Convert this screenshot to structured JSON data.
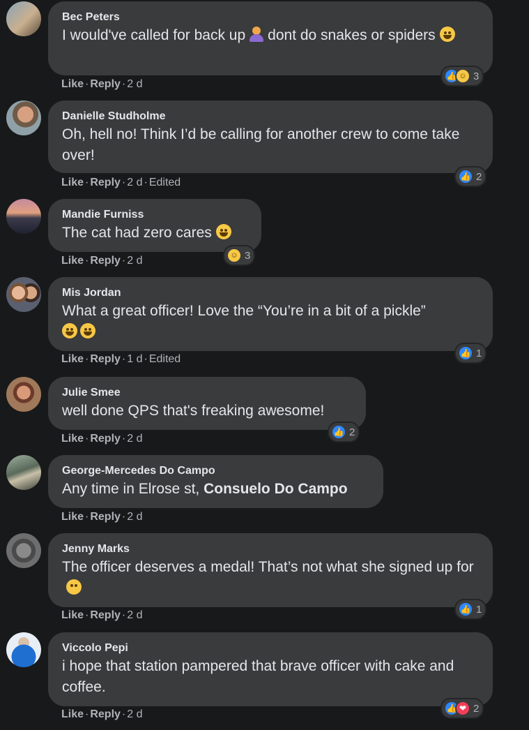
{
  "labels": {
    "like": "Like",
    "reply": "Reply",
    "separator": "·"
  },
  "comments": [
    {
      "author": "Bec Peters",
      "text_a": "I would've called for back up",
      "text_b": "dont do snakes or spiders",
      "time": "2 d",
      "edited": "",
      "reactions": [
        "like",
        "haha"
      ],
      "count": "3"
    },
    {
      "author": "Danielle Studholme",
      "text": "Oh, hell no! Think I’d be calling for another crew to come take over!",
      "time": "2 d",
      "edited": "Edited",
      "reactions": [
        "like"
      ],
      "count": "2"
    },
    {
      "author": "Mandie Furniss",
      "text": "The cat had zero cares",
      "time": "2 d",
      "edited": "",
      "reactions": [
        "haha"
      ],
      "count": "3"
    },
    {
      "author": "Mis Jordan",
      "text": "What a great officer! Love the “You’re in a bit of a pickle”",
      "time": "1 d",
      "edited": "Edited",
      "reactions": [
        "like"
      ],
      "count": "1"
    },
    {
      "author": "Julie Smee",
      "text": "well done QPS that's freaking awesome!",
      "time": "2 d",
      "edited": "",
      "reactions": [
        "like"
      ],
      "count": "2"
    },
    {
      "author": "George-Mercedes Do Campo",
      "text": "Any time in Elrose st,",
      "mention": "Consuelo Do Campo",
      "time": "2 d",
      "edited": "",
      "reactions": [],
      "count": ""
    },
    {
      "author": "Jenny Marks",
      "text": "The officer deserves a medal! That’s not what she signed up for",
      "time": "2 d",
      "edited": "",
      "reactions": [
        "like"
      ],
      "count": "1"
    },
    {
      "author": "Viccolo Pepi",
      "text": "i hope that station pampered that brave officer with cake and coffee.",
      "time": "2 d",
      "edited": "",
      "reactions": [
        "like",
        "love"
      ],
      "count": "2"
    }
  ],
  "icons": {
    "like_reaction": "thumbs-up-icon",
    "haha_reaction": "laughing-face-icon",
    "love_reaction": "heart-icon"
  },
  "colors": {
    "background": "#18191a",
    "bubble": "#3a3b3c",
    "text": "#e4e6eb",
    "muted": "#b0b3b8",
    "like_blue": "#2d88ff",
    "love_red": "#f33e58",
    "haha_yellow": "#f7c846"
  }
}
